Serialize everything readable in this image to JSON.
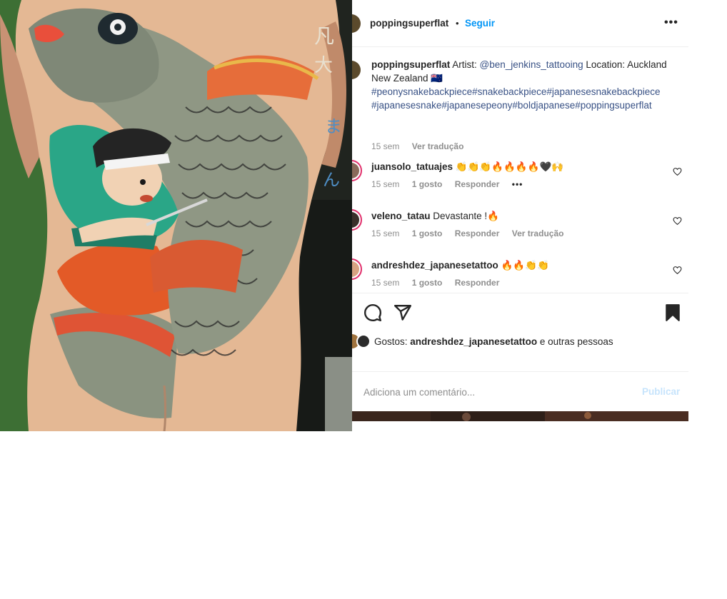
{
  "post": {
    "image_alt": "Japanese style back-piece tattoo of a koi carp with a warrior figure",
    "header": {
      "username": "poppingsuperflat",
      "separator": "•",
      "follow_label": "Seguir",
      "more_label": "•••"
    },
    "caption": {
      "username": "poppingsuperflat",
      "text_prefix": "Artist: ",
      "mention": "@ben_jenkins_tattooing",
      "text_middle": " Location: Auckland New Zealand 🇳🇿",
      "line_hashtags_1": "#peonysnakebackpiece#snakebackpiece#japanesesnakebackpiece",
      "line_hashtags_2": "#japanesesnake#japanesepeony#boldjapanese#poppingsuperflat",
      "time": "15 sem",
      "translate": "Ver tradução"
    },
    "comments": [
      {
        "username": "juansolo_tatuajes",
        "text": "👏👏👏🔥🔥🔥🔥🖤🙌",
        "time": "15 sem",
        "likes": "1 gosto",
        "reply": "Responder",
        "more": "•••"
      },
      {
        "username": "veleno_tatau",
        "text": "Devastante !🔥",
        "time": "15 sem",
        "likes": "1 gosto",
        "reply": "Responder",
        "translate": "Ver tradução"
      },
      {
        "username": "andreshdez_japanesetattoo",
        "text": "🔥🔥👏👏",
        "time": "15 sem",
        "likes": "1 gosto",
        "reply": "Responder"
      }
    ],
    "likes": {
      "prefix": "Gostos: ",
      "user": "andreshdez_japanesetattoo",
      "suffix": " e outras pessoas"
    },
    "add_comment": {
      "placeholder": "Adiciona um comentário...",
      "publish_label": "Publicar"
    },
    "icons": {
      "comment": "comment-icon",
      "share": "share-icon",
      "save": "bookmark-icon",
      "heart": "heart-icon",
      "more": "more-icon"
    },
    "colors": {
      "follow": "#0095f6",
      "link": "#385185",
      "meta": "#8e8e8e",
      "publish_disabled": "#c7e4fc"
    }
  }
}
